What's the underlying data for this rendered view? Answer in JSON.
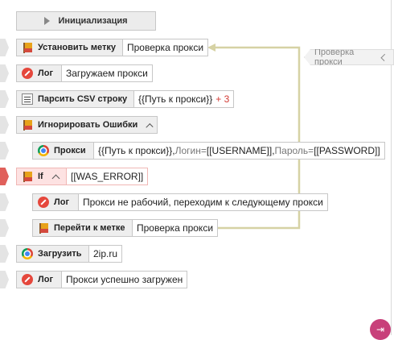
{
  "blocks": {
    "init": {
      "label": "Инициализация"
    },
    "set_label": {
      "label": "Установить метку",
      "value": "Проверка прокси"
    },
    "log1": {
      "label": "Лог",
      "value": "Загружаем прокси"
    },
    "parse_csv": {
      "label": "Парсить CSV строку",
      "value": "{{Путь к прокси}}",
      "plus": "+ 3"
    },
    "ignore_errors": {
      "label": "Игнорировать Ошибки"
    },
    "proxy": {
      "label": "Прокси",
      "v1": "{{Путь к прокси}},",
      "k2": " Логин=",
      "v2": "[[USERNAME]],",
      "k3": " Пароль=",
      "v3": "[[PASSWORD]]"
    },
    "if": {
      "label": "If",
      "value": "[[WAS_ERROR]]"
    },
    "log2": {
      "label": "Лог",
      "value": "Прокси не рабочий, переходим к следующему прокси"
    },
    "goto_label": {
      "label": "Перейти к метке",
      "value": "Проверка прокси"
    },
    "load": {
      "label": "Загрузить",
      "value": "2ip.ru"
    },
    "log3": {
      "label": "Лог",
      "value": "Прокси успешно загружен"
    }
  },
  "side_tag": {
    "label": "Проверка прокси"
  },
  "icons": {
    "init": "play-icon",
    "set_label": "flag-icon",
    "log": "log-icon",
    "parse_csv": "csv-icon",
    "ignore_errors": "flag-icon",
    "proxy": "chrome-icon",
    "if": "flag-icon",
    "goto_label": "flag-icon",
    "load": "chrome-icon",
    "corner": "exit-icon"
  },
  "colors": {
    "block_bg": "#eeeeee",
    "error_bg": "#fde2e2",
    "connector": "#d6d2a4",
    "accent_red": "#e5473c",
    "corner_button": "#c8407a"
  }
}
